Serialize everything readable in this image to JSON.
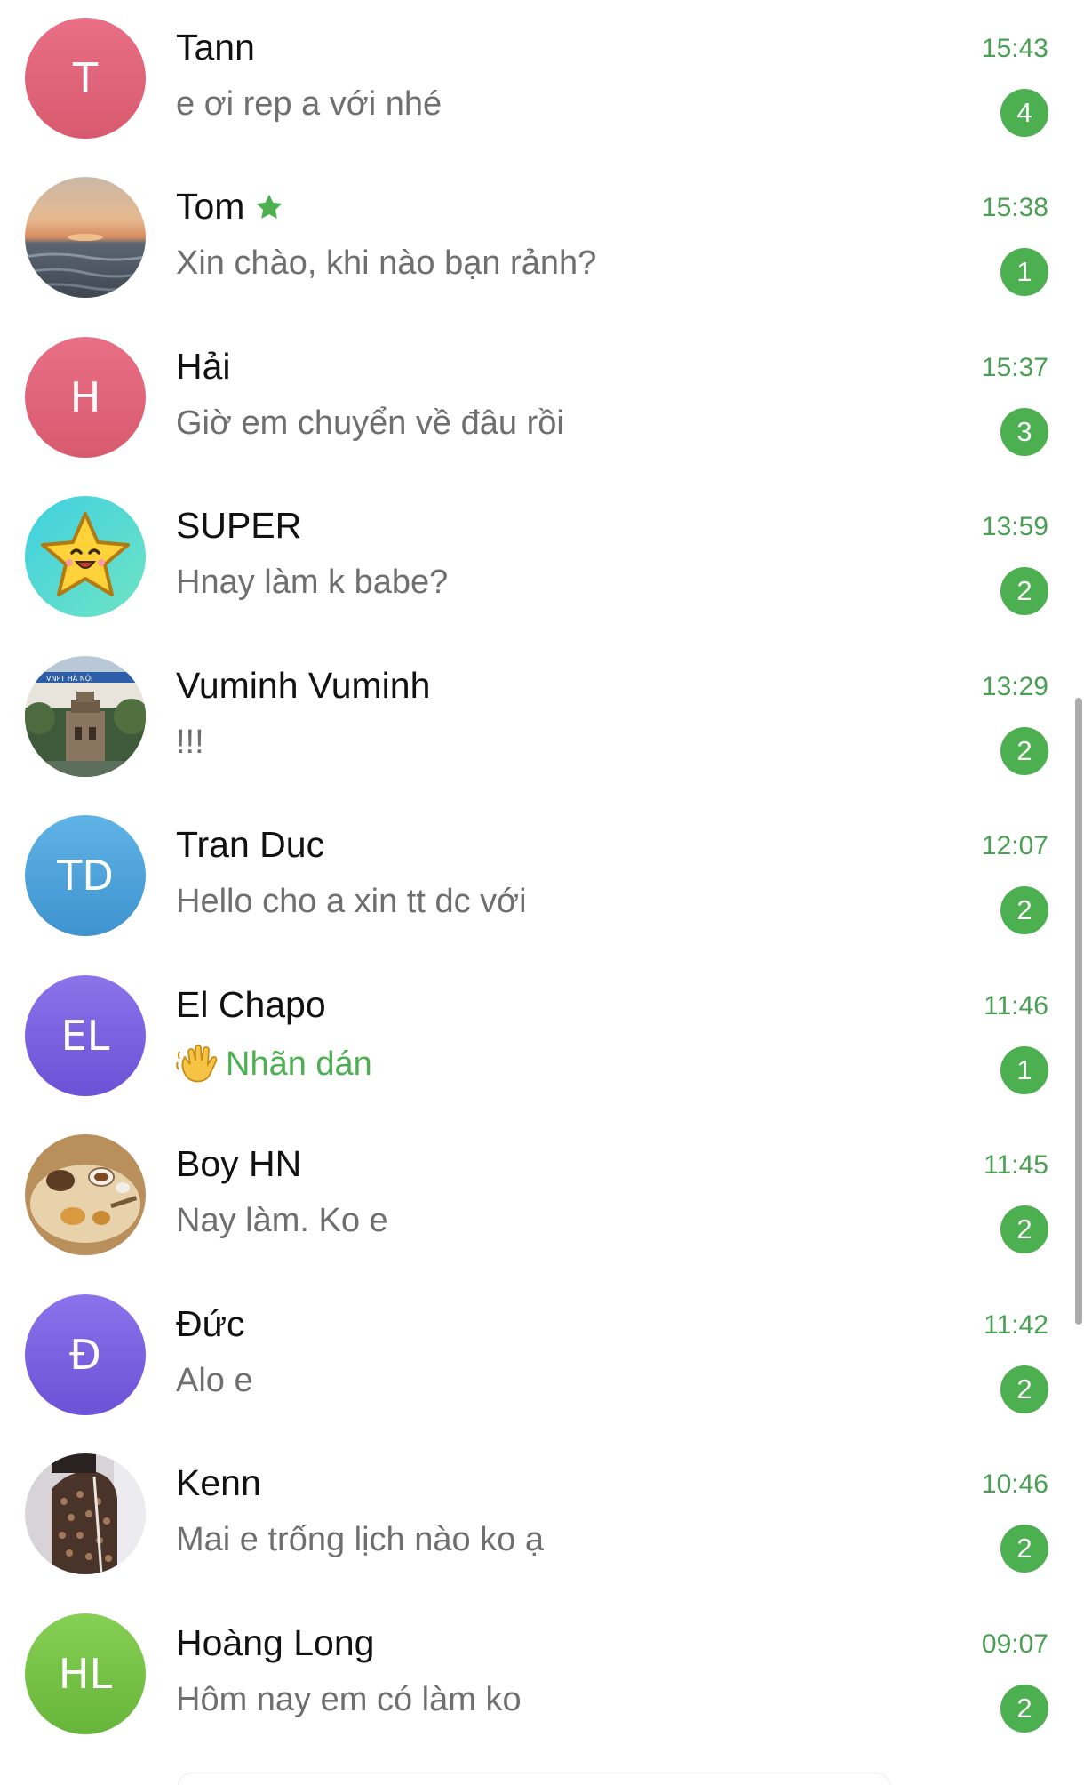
{
  "colors": {
    "accent": "#4caf50",
    "time_text": "#4a9f54",
    "name_text": "#111111",
    "preview_text": "#6f6f6f"
  },
  "chats": [
    {
      "name": "Tann",
      "preview": "e ơi rep a với nhé",
      "time": "15:43",
      "unread": "4",
      "avatar": {
        "type": "initials",
        "initials": "T",
        "color": "#e0657a"
      }
    },
    {
      "name": "Tom",
      "preview": "Xin chào, khi nào bạn rảnh?",
      "time": "15:38",
      "unread": "1",
      "starred": true,
      "avatar": {
        "type": "photo",
        "subject": "sunset-sea"
      }
    },
    {
      "name": "Hải",
      "preview": "Giờ em chuyển về đâu rồi",
      "time": "15:37",
      "unread": "3",
      "avatar": {
        "type": "initials",
        "initials": "H",
        "color": "#e0657a"
      }
    },
    {
      "name": "SUPER",
      "preview": "Hnay làm k babe?",
      "time": "13:59",
      "unread": "2",
      "avatar": {
        "type": "photo",
        "subject": "cartoon-star"
      }
    },
    {
      "name": "Vuminh Vuminh",
      "preview": "!!!",
      "time": "13:29",
      "unread": "2",
      "avatar": {
        "type": "photo",
        "subject": "hanoi-tower",
        "photo_caption": "VNPT HÀ NỘI"
      }
    },
    {
      "name": "Tran Duc",
      "preview": "Hello cho a xin tt dc với",
      "time": "12:07",
      "unread": "2",
      "avatar": {
        "type": "initials",
        "initials": "TD",
        "color": "#4ea3dc"
      }
    },
    {
      "name": "El Chapo",
      "preview": "Nhãn dán",
      "preview_type": "sticker",
      "time": "11:46",
      "unread": "1",
      "avatar": {
        "type": "initials",
        "initials": "EL",
        "color": "#7b61e0"
      }
    },
    {
      "name": "Boy HN",
      "preview": "Nay làm. Ko e",
      "time": "11:45",
      "unread": "2",
      "avatar": {
        "type": "photo",
        "subject": "tea-table"
      }
    },
    {
      "name": "Đức",
      "preview": "Alo e",
      "time": "11:42",
      "unread": "2",
      "avatar": {
        "type": "initials",
        "initials": "Đ",
        "color": "#7b61e0"
      }
    },
    {
      "name": "Kenn",
      "preview": "Mai e trống lịch nào ko ạ",
      "time": "10:46",
      "unread": "2",
      "avatar": {
        "type": "photo",
        "subject": "person-patterned-shirt"
      }
    },
    {
      "name": "Hoàng Long",
      "preview": "Hôm nay em có làm ko",
      "time": "09:07",
      "unread": "2",
      "avatar": {
        "type": "initials",
        "initials": "HL",
        "color": "#76c44a"
      }
    }
  ]
}
